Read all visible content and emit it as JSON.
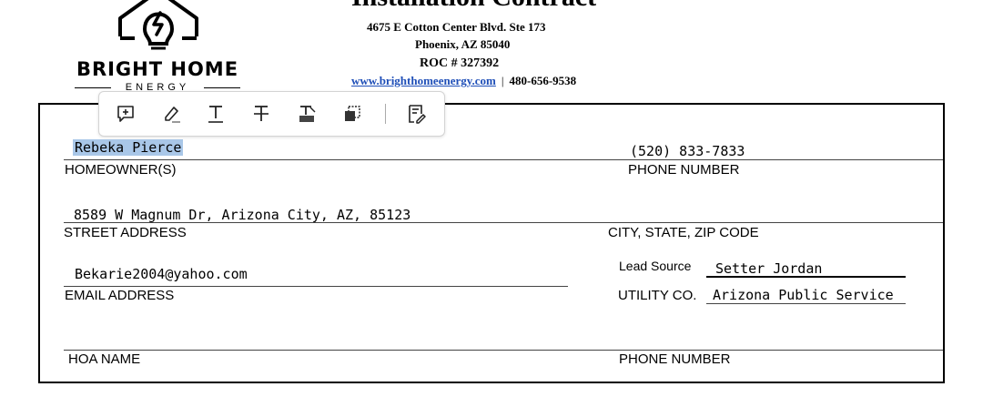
{
  "company": {
    "logo_name": "BRIGHT HOME",
    "logo_sub": "ENERGY",
    "title": "Installation Contract",
    "address_line1": "4675 E Cotton Center Blvd. Ste 173",
    "address_line2": "Phoenix, AZ 85040",
    "roc": "ROC # 327392",
    "website": "www.brighthomeenergy.com",
    "separator": "|",
    "phone": "480-656-9538"
  },
  "toolbar": {
    "items": [
      "add-comment",
      "highlight",
      "add-text",
      "strikethrough",
      "replace-text",
      "copy",
      "summarize"
    ]
  },
  "form": {
    "homeowner": {
      "label": "HOMEOWNER(S)",
      "value": "Rebeka Pierce"
    },
    "phone1": {
      "label": "PHONE NUMBER",
      "value": "(520) 833-7833"
    },
    "street": {
      "label": "STREET ADDRESS",
      "value": "8589 W Magnum Dr, Arizona City, AZ, 85123"
    },
    "city_state_zip": {
      "label": "CITY, STATE, ZIP CODE",
      "value": ""
    },
    "email": {
      "label": "EMAIL ADDRESS",
      "value": "Bekarie2004@yahoo.com"
    },
    "lead_source": {
      "label": "Lead Source",
      "value": "Setter Jordan"
    },
    "utility": {
      "label": "UTILITY CO.",
      "value": "Arizona Public Service"
    },
    "hoa": {
      "label": "HOA NAME",
      "value": ""
    },
    "phone2": {
      "label": "PHONE NUMBER",
      "value": ""
    }
  }
}
